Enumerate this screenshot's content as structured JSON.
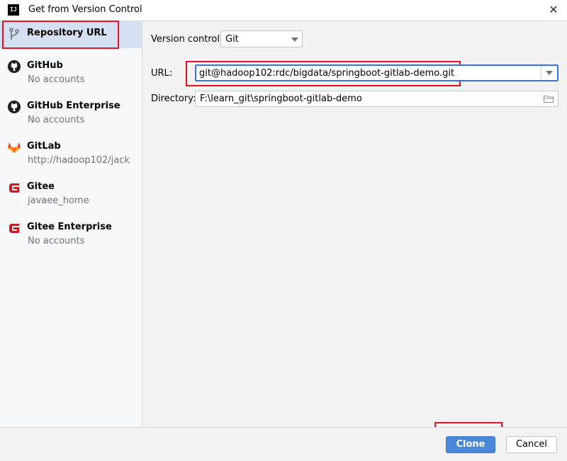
{
  "window": {
    "title": "Get from Version Control",
    "app_icon_text": "IJ"
  },
  "sidebar": {
    "items": [
      {
        "label": "Repository URL",
        "sub": "",
        "icon": "vcs-branch-icon"
      },
      {
        "label": "GitHub",
        "sub": "No accounts",
        "icon": "github-icon"
      },
      {
        "label": "GitHub Enterprise",
        "sub": "No accounts",
        "icon": "github-icon"
      },
      {
        "label": "GitLab",
        "sub": "http://hadoop102/jack",
        "icon": "gitlab-icon"
      },
      {
        "label": "Gitee",
        "sub": "javaee_home",
        "icon": "gitee-icon"
      },
      {
        "label": "Gitee Enterprise",
        "sub": "No accounts",
        "icon": "gitee-icon"
      }
    ]
  },
  "form": {
    "vcs_label": "Version control:",
    "vcs_value": "Git",
    "url_label": "URL:",
    "url_value": "git@hadoop102:rdc/bigdata/springboot-gitlab-demo.git",
    "dir_label": "Directory:",
    "dir_value": "F:\\learn_git\\springboot-gitlab-demo"
  },
  "buttons": {
    "clone": "Clone",
    "cancel": "Cancel"
  },
  "colors": {
    "highlight": "#e81123",
    "accent": "#3574f0",
    "gitlab": "#e24329",
    "gitee": "#c71d23"
  }
}
